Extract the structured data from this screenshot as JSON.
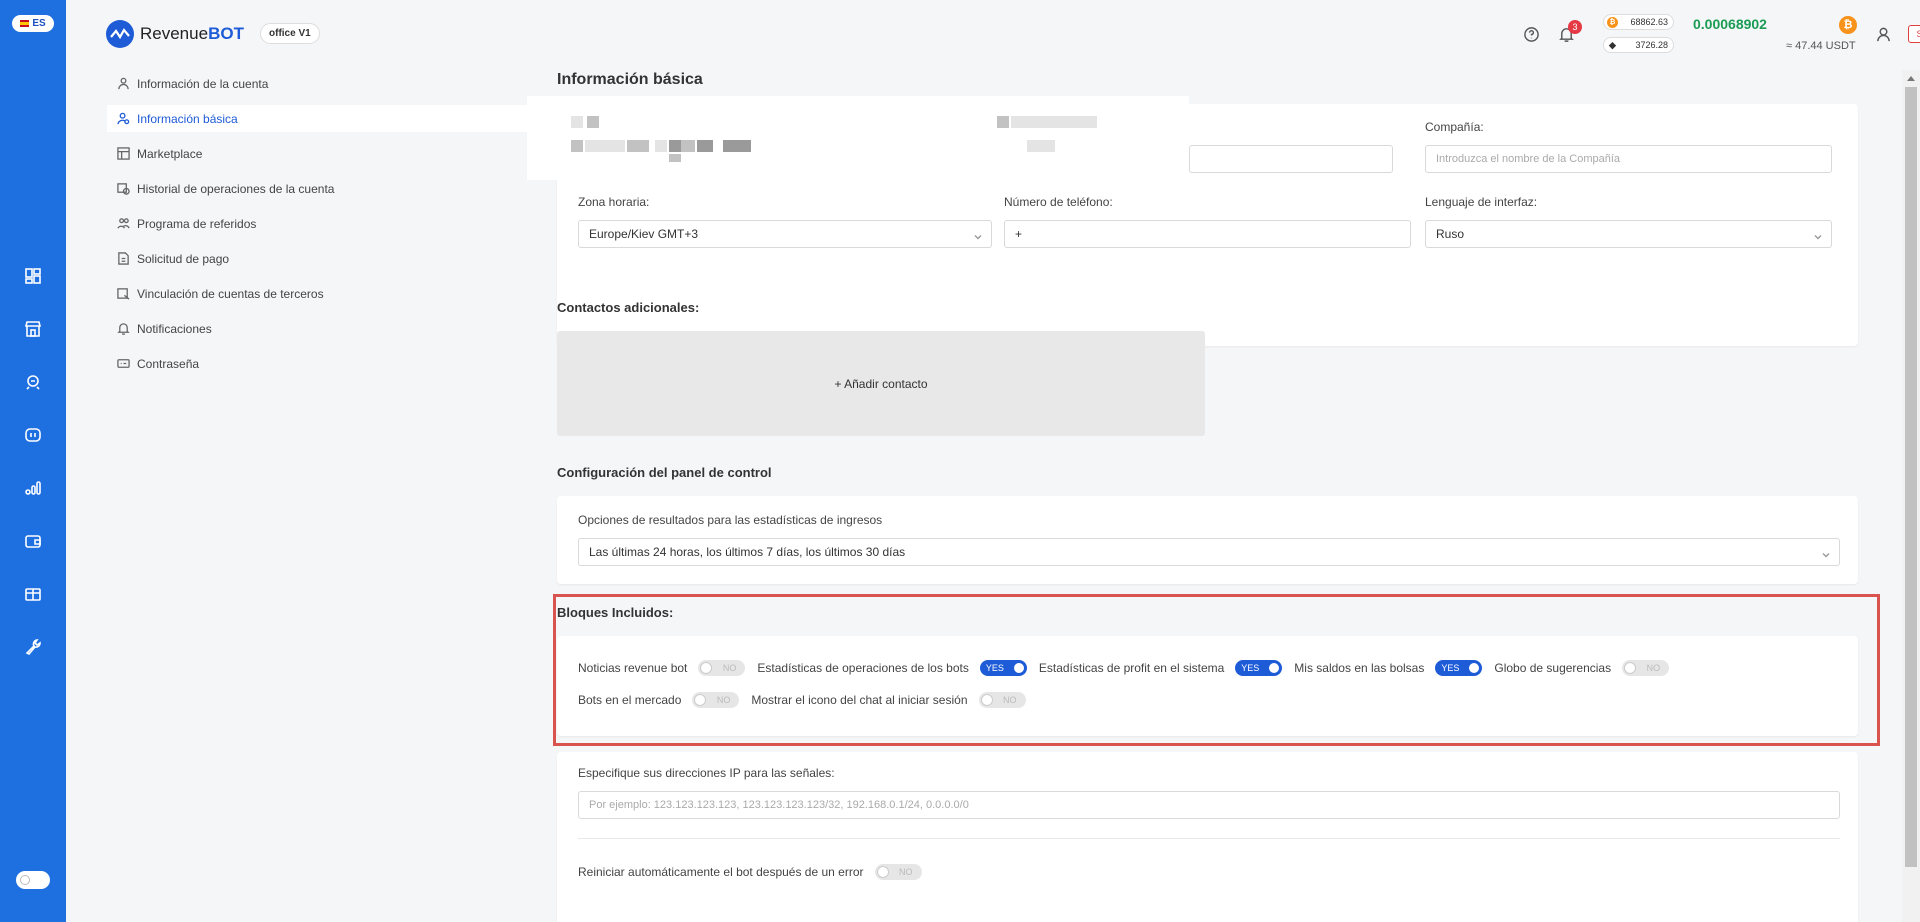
{
  "language": {
    "code": "ES"
  },
  "brand": {
    "name_regular": "Revenue",
    "name_bold": "BOT",
    "office_badge": "office V1"
  },
  "header": {
    "notifications_count": "3",
    "btc_price": "68862.63",
    "eth_price": "3726.28",
    "balance_btc": "0.00068902",
    "balance_usdt": "≈ 47.44 USDT",
    "logout_label": "Salir"
  },
  "rail_icons": [
    "dashboard-icon",
    "store-icon",
    "robot-icon",
    "signals-icon",
    "stats-icon",
    "wallet-icon",
    "gift-icon",
    "tools-icon"
  ],
  "menu": {
    "items": [
      {
        "label": "Información de la cuenta",
        "icon": "user-icon",
        "active": false
      },
      {
        "label": "Información básica",
        "icon": "user-settings-icon",
        "active": true
      },
      {
        "label": "Marketplace",
        "icon": "marketplace-icon",
        "active": false
      },
      {
        "label": "Historial de operaciones de la cuenta",
        "icon": "history-icon",
        "active": false
      },
      {
        "label": "Programa de referidos",
        "icon": "referral-icon",
        "active": false
      },
      {
        "label": "Solicitud de pago",
        "icon": "payment-request-icon",
        "active": false
      },
      {
        "label": "Vinculación de cuentas de terceros",
        "icon": "link-accounts-icon",
        "active": false
      },
      {
        "label": "Notificaciones",
        "icon": "bell-icon",
        "active": false
      },
      {
        "label": "Contraseña",
        "icon": "password-icon",
        "active": false
      }
    ]
  },
  "basic_info": {
    "title": "Información básica",
    "company_label": "Compañía:",
    "company_placeholder": "Introduzca el nombre de la Compañía",
    "timezone_label": "Zona horaria:",
    "timezone_value": "Europe/Kiev GMT+3",
    "phone_label": "Número de teléfono:",
    "phone_value": "+",
    "language_label": "Lenguaje de interfaz:",
    "language_value": "Ruso"
  },
  "contacts": {
    "title": "Contactos adicionales:",
    "add_label": "+ Añadir contacto"
  },
  "dashboard_settings": {
    "title": "Configuración del panel de control",
    "stats_label": "Opciones de resultados para las estadísticas de ingresos",
    "stats_value": "Las últimas 24 horas, los últimos 7 días, los últimos 30 días"
  },
  "blocks": {
    "title": "Bloques Incluidos:",
    "row1": [
      {
        "label": "Noticias revenue bot",
        "state": "NO"
      },
      {
        "label": "Estadísticas de operaciones de los bots",
        "state": "YES"
      },
      {
        "label": "Estadísticas de profit en el sistema",
        "state": "YES"
      },
      {
        "label": "Mis saldos en las bolsas",
        "state": "YES"
      },
      {
        "label": "Globo de sugerencias",
        "state": "NO"
      }
    ],
    "row2": [
      {
        "label": "Bots en el mercado",
        "state": "NO"
      },
      {
        "label": "Mostrar el icono del chat al iniciar sesión",
        "state": "NO"
      }
    ]
  },
  "ip": {
    "label": "Especifique sus direcciones IP para las señales:",
    "placeholder": "Por ejemplo: 123.123.123.123, 123.123.123.123/32, 192.168.0.1/24, 0.0.0.0/0"
  },
  "restart": {
    "label": "Reiniciar automáticamente el bot después de un error",
    "state": "NO"
  },
  "colors": {
    "rail": "#1e6fe0",
    "accent": "#1e5bd6",
    "balance": "#1a9c55",
    "highlight": "#d9534f"
  }
}
